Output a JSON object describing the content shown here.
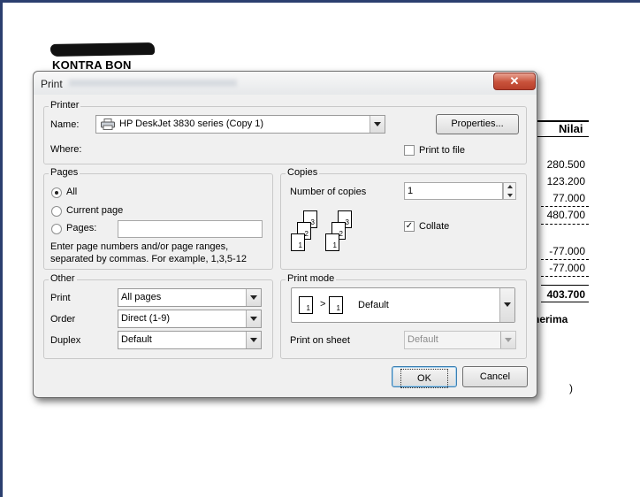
{
  "report": {
    "title": "KONTRA BON",
    "column_header": "Nilai",
    "values": [
      "280.500",
      "123.200",
      "77.000",
      "480.700",
      "-77.000",
      "-77.000",
      "403.700"
    ],
    "partial_text_1": "nerima",
    "partial_text_2": ")"
  },
  "dialog": {
    "title": "Print",
    "close_glyph": "✕",
    "printer": {
      "legend": "Printer",
      "name_label": "Name:",
      "name_value": "HP DeskJet 3830 series (Copy 1)",
      "properties_label": "Properties...",
      "where_label": "Where:",
      "print_to_file_label": "Print to file"
    },
    "pages": {
      "legend": "Pages",
      "all_label": "All",
      "current_label": "Current page",
      "pages_label": "Pages:",
      "pages_value": "",
      "hint_line1": "Enter page numbers and/or page ranges,",
      "hint_line2": "separated by commas. For example, 1,3,5-12"
    },
    "copies": {
      "legend": "Copies",
      "number_label": "Number of copies",
      "number_value": "1",
      "collate_label": "Collate",
      "collate_checked": true,
      "collate_glyph": "✓"
    },
    "other": {
      "legend": "Other",
      "print_label": "Print",
      "print_value": "All pages",
      "order_label": "Order",
      "order_value": "Direct (1-9)",
      "duplex_label": "Duplex",
      "duplex_value": "Default"
    },
    "print_mode": {
      "legend": "Print mode",
      "mode_value": "Default",
      "arrow_glyph": ">",
      "print_on_sheet_label": "Print on sheet",
      "print_on_sheet_value": "Default"
    },
    "ok_label": "OK",
    "cancel_label": "Cancel"
  }
}
